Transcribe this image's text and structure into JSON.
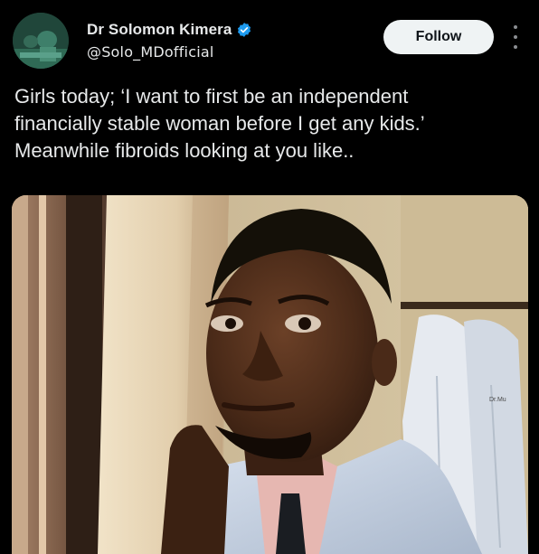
{
  "author": {
    "display_name": "Dr Solomon Kimera",
    "handle": "@Solo_MDofficial",
    "verified": true,
    "avatar_icon": "profile-photo-avatar"
  },
  "actions": {
    "follow_label": "Follow",
    "more_icon": "more-vertical-icon"
  },
  "tweet": {
    "lines": [
      "Girls today; ‘I want to first be an independent",
      "financially stable woman before I get any kids.’",
      "Meanwhile fibroids looking at you like.."
    ]
  },
  "media": {
    "coat_label": "Dr.Mu"
  },
  "colors": {
    "background": "#000000",
    "text": "#e7e9ea",
    "verified_blue": "#1d9bf0",
    "follow_bg": "#eff3f4"
  }
}
